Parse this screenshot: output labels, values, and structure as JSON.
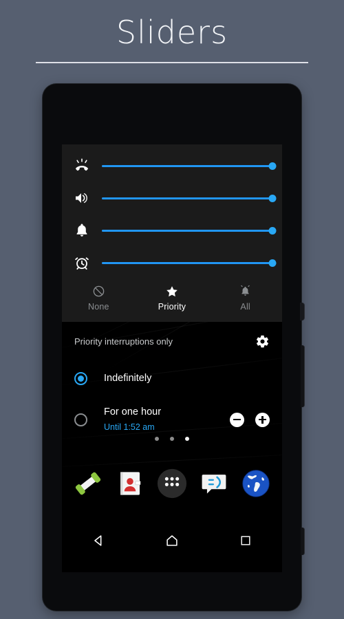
{
  "header": {
    "title": "Sliders"
  },
  "phone": {
    "side_buttons": [
      {
        "name": "power-button"
      },
      {
        "name": "volume-rocker"
      },
      {
        "name": "camera-button"
      }
    ]
  },
  "quick_settings": {
    "sliders": [
      {
        "name": "ringer-volume",
        "icon": "ringer-phone-icon",
        "value": 100
      },
      {
        "name": "media-volume",
        "icon": "speaker-icon",
        "value": 100
      },
      {
        "name": "notification-volume",
        "icon": "bell-icon",
        "value": 100
      },
      {
        "name": "alarm-volume",
        "icon": "alarm-clock-icon",
        "value": 100
      }
    ],
    "modes": [
      {
        "label": "None",
        "icon": "block-circle-icon",
        "active": false
      },
      {
        "label": "Priority",
        "icon": "star-icon",
        "active": true
      },
      {
        "label": "All",
        "icon": "ringing-bell-icon",
        "active": false
      }
    ]
  },
  "priority_panel": {
    "header": "Priority interruptions only",
    "settings_icon": "gear-icon",
    "options": [
      {
        "label": "Indefinitely",
        "sublabel": "",
        "selected": true,
        "has_stepper": false
      },
      {
        "label": "For one hour",
        "sublabel": "Until 1:52 am",
        "selected": false,
        "has_stepper": true,
        "minus_label": "−",
        "plus_label": "+"
      }
    ]
  },
  "home": {
    "page_dots": [
      {
        "active": false
      },
      {
        "active": false
      },
      {
        "active": true
      }
    ],
    "dock": [
      {
        "name": "phone-app",
        "icon": "phone-handset-icon"
      },
      {
        "name": "contacts-app",
        "icon": "contacts-icon"
      },
      {
        "name": "app-drawer",
        "icon": "app-drawer-icon"
      },
      {
        "name": "messaging-app",
        "icon": "message-bubble-icon"
      },
      {
        "name": "browser-app",
        "icon": "globe-icon"
      }
    ]
  },
  "navbar": [
    {
      "name": "back-button",
      "icon": "back-triangle-icon"
    },
    {
      "name": "home-button",
      "icon": "home-house-icon"
    },
    {
      "name": "recents-button",
      "icon": "recents-square-icon"
    }
  ],
  "colors": {
    "background": "#565f70",
    "accent_blue": "#29a8f5",
    "panel": "#1b1b1b",
    "screen": "#000000"
  }
}
